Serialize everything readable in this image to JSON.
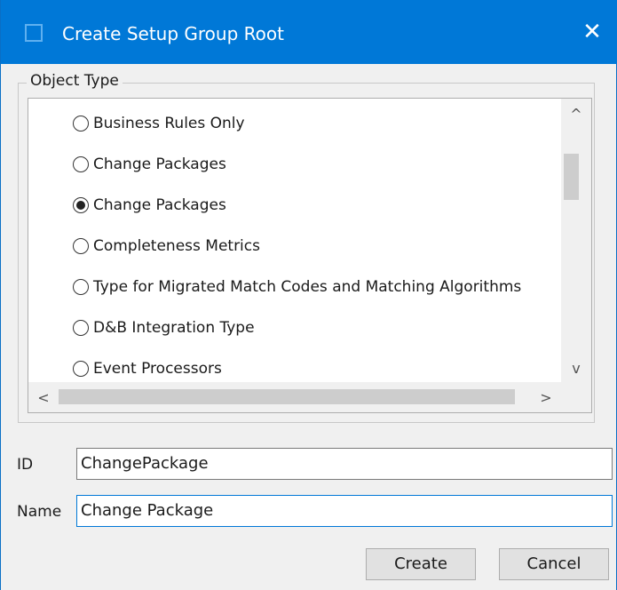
{
  "window": {
    "title": "Create Setup Group Root",
    "close_glyph": "✕"
  },
  "object_type": {
    "legend": "Object Type",
    "items": [
      {
        "label": "Business Rules Only",
        "selected": false
      },
      {
        "label": "Change Packages",
        "selected": false
      },
      {
        "label": "Change Packages",
        "selected": true
      },
      {
        "label": "Completeness Metrics",
        "selected": false
      },
      {
        "label": "Type for Migrated Match Codes and Matching Algorithms",
        "selected": false
      },
      {
        "label": "D&B Integration Type",
        "selected": false
      },
      {
        "label": "Event Processors",
        "selected": false
      }
    ],
    "scroll": {
      "up_glyph": "^",
      "down_glyph": "v",
      "left_glyph": "<",
      "right_glyph": ">"
    }
  },
  "form": {
    "id_label": "ID",
    "id_value": "ChangePackage",
    "name_label": "Name",
    "name_value": "Change Package"
  },
  "buttons": {
    "create": "Create",
    "cancel": "Cancel"
  },
  "colors": {
    "titlebar": "#0078d7",
    "dialog_bg": "#f0f0f0"
  }
}
